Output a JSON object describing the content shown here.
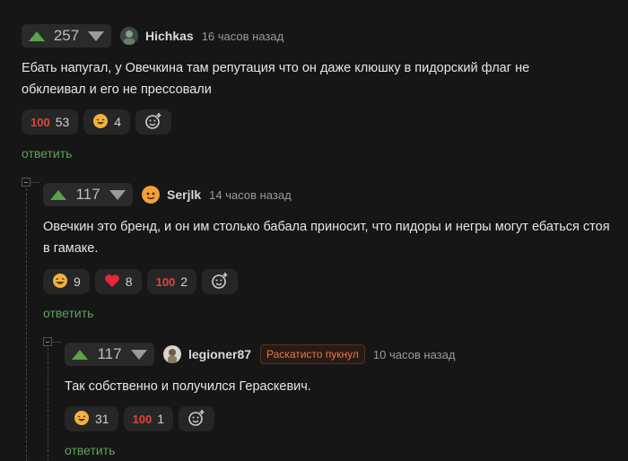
{
  "comments": [
    {
      "score": "257",
      "username": "Hichkas",
      "time": "16 часов назад",
      "text": "Ебать напугал, у Овечкина там репутация что он даже клюшку в пидорский флаг не обклеивал и его не прессовали",
      "reactions": [
        {
          "icon": "hundred-points",
          "glyph": "💯",
          "count": "53"
        },
        {
          "icon": "grinning-face",
          "glyph": "😆",
          "count": "4"
        }
      ],
      "reply_label": "ответить"
    },
    {
      "score": "117",
      "username": "Serjlk",
      "time": "14 часов назад",
      "text": "Овечкин это бренд, и он им столько бабала приносит, что пидоры и негры могут ебаться стоя в гамаке.",
      "reactions": [
        {
          "icon": "laughing-face",
          "glyph": "😆",
          "count": "9"
        },
        {
          "icon": "heart",
          "glyph": "❤",
          "count": "8"
        },
        {
          "icon": "hundred-points",
          "glyph": "💯",
          "count": "2"
        }
      ],
      "reply_label": "ответить"
    },
    {
      "score": "117",
      "username": "legioner87",
      "badge": "Раскатисто пукнул",
      "time": "10 часов назад",
      "text": "Так собственно и получился Гераскевич.",
      "reactions": [
        {
          "icon": "grinning-face",
          "glyph": "😆",
          "count": "31"
        },
        {
          "icon": "hundred-points",
          "glyph": "💯",
          "count": "1"
        }
      ],
      "reply_label": "ответить"
    }
  ],
  "colors": {
    "background": "#161616",
    "upvote": "#5aa34a",
    "reply": "#5fa35a",
    "badge_text": "#e37a4a"
  }
}
